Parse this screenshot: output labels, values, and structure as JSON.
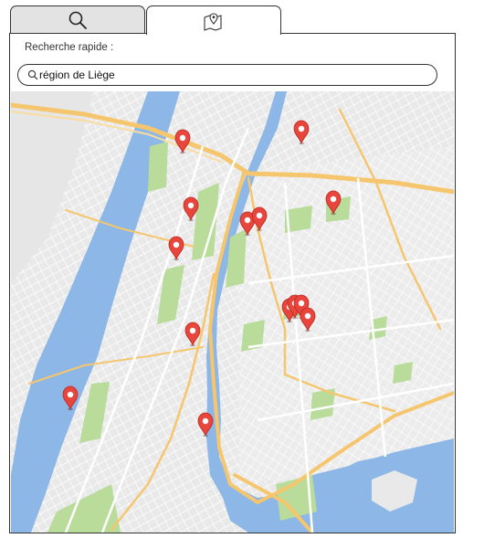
{
  "tabs": [
    {
      "id": "search",
      "icon": "search-icon",
      "active": false
    },
    {
      "id": "map",
      "icon": "map-pin-icon",
      "active": true
    }
  ],
  "search": {
    "label": "Recherche rapide :",
    "value": "région de Liège",
    "placeholder": ""
  },
  "map": {
    "marker_count": 14,
    "colors": {
      "land": "#ebebeb",
      "water": "#8db7e6",
      "park": "#b9dc9b",
      "highway": "#f5c66e",
      "street": "#ffffff",
      "marker": "#e8463c"
    }
  }
}
